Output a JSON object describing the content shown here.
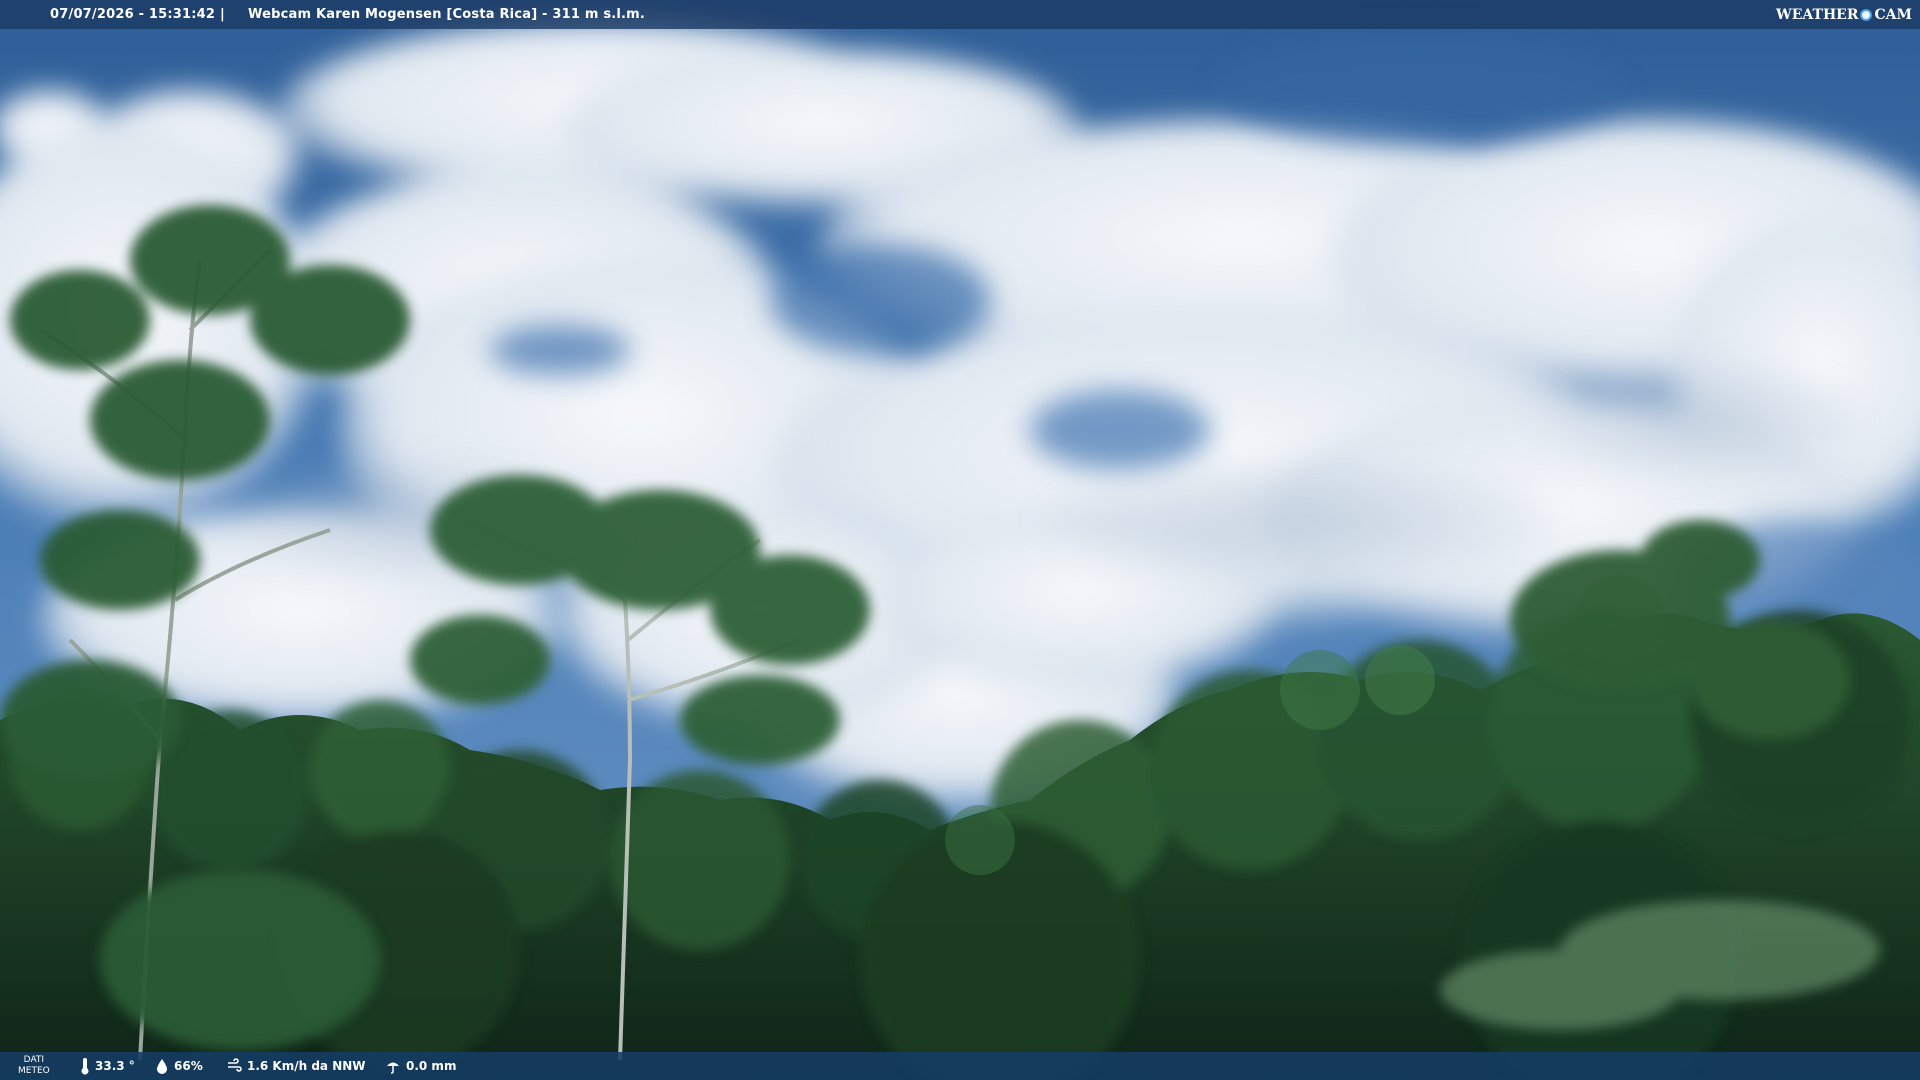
{
  "topbar": {
    "timestamp": "07/07/2026 - 15:31:42",
    "separator": "|",
    "camera_title": "Webcam Karen Mogensen [Costa Rica]  - 311 m s.l.m.",
    "brand_left": "WEATHER",
    "brand_right": "CAM"
  },
  "bottombar": {
    "dati_line1": "DATI",
    "dati_line2": "METEO",
    "temperature": "33.3 °",
    "humidity": "66%",
    "wind": "1.6 Km/h da NNW",
    "rain": "0.0 mm"
  },
  "icons": {
    "temperature": "thermometer-icon",
    "humidity": "humidity-drop-icon",
    "wind": "wind-icon",
    "rain": "rain-gauge-icon",
    "brand": "weathercam-logo"
  },
  "colors": {
    "sky_top": "#2f5f97",
    "sky_mid": "#4e7fb8",
    "cloud": "#eef2f7",
    "forest_dark": "#122a1c",
    "forest_mid": "#1f4a2c",
    "foliage_light": "#3f7a46",
    "bar": "#1c3a64"
  }
}
